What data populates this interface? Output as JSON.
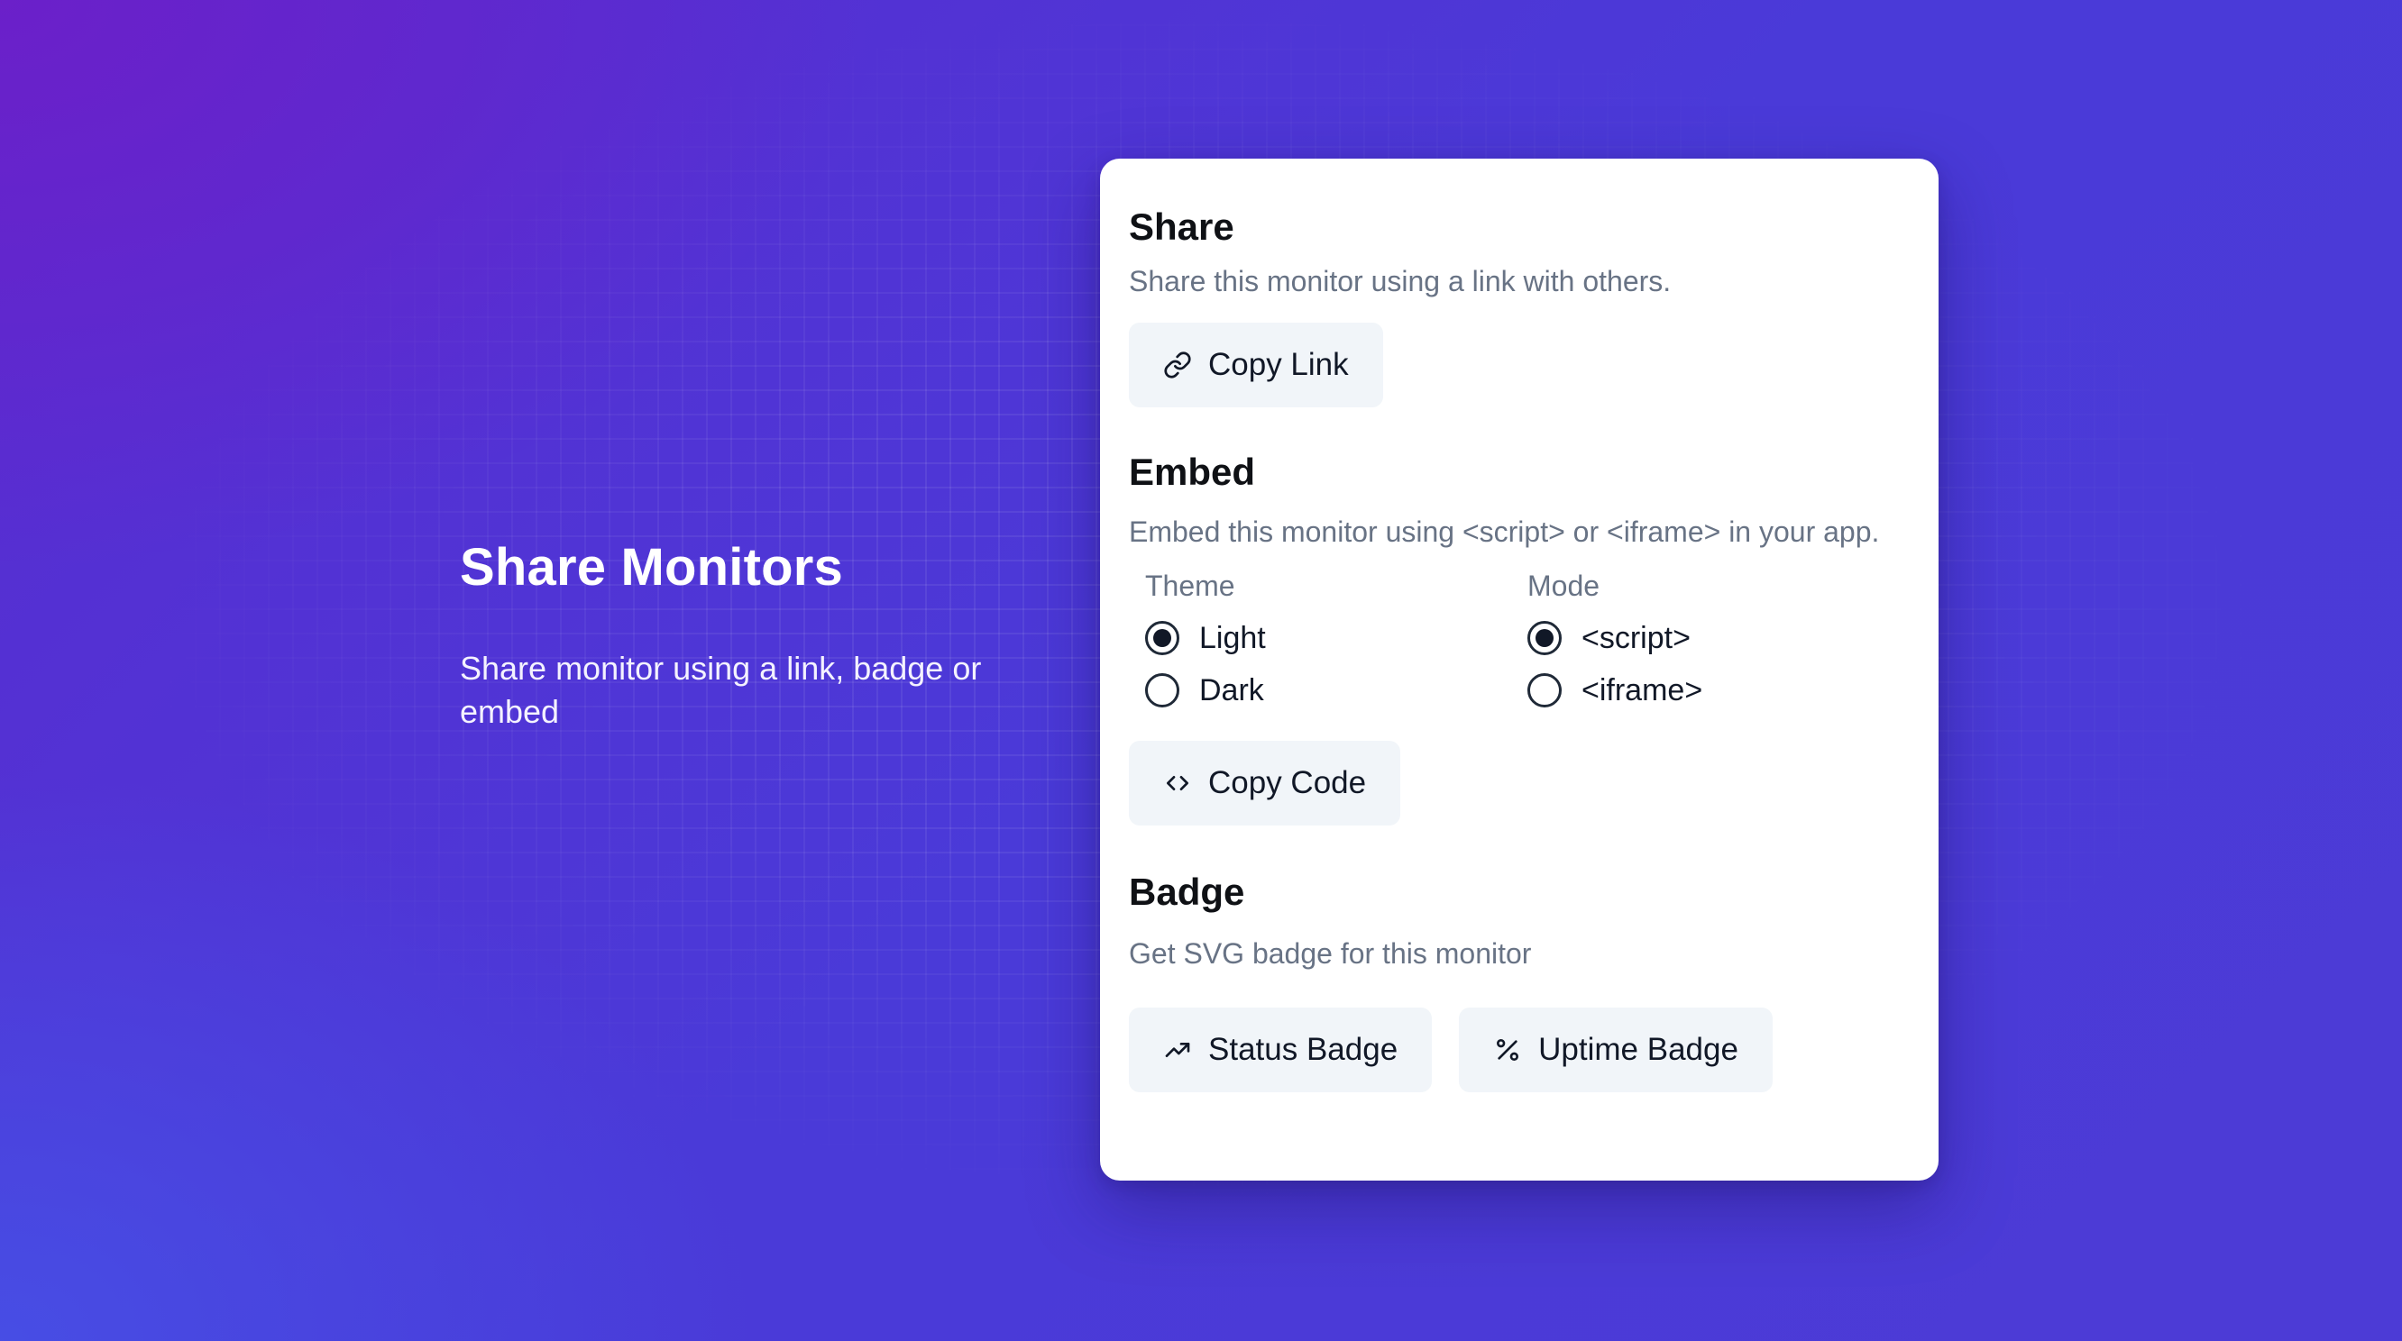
{
  "intro": {
    "title": "Share Monitors",
    "description": "Share monitor using a link, badge or embed"
  },
  "share": {
    "title": "Share",
    "description": "Share this monitor using a link with others.",
    "copy_link_label": "Copy Link",
    "copy_link_icon": "link-icon"
  },
  "embed": {
    "title": "Embed",
    "description": "Embed this monitor using <script> or <iframe> in your app.",
    "theme": {
      "label": "Theme",
      "options": [
        {
          "label": "Light",
          "selected": true
        },
        {
          "label": "Dark",
          "selected": false
        }
      ]
    },
    "mode": {
      "label": "Mode",
      "options": [
        {
          "label": "<script>",
          "selected": true
        },
        {
          "label": "<iframe>",
          "selected": false
        }
      ]
    },
    "copy_code_label": "Copy Code",
    "copy_code_icon": "code-icon"
  },
  "badge": {
    "title": "Badge",
    "description": "Get SVG badge for this monitor",
    "status_badge_label": "Status Badge",
    "status_badge_icon": "trending-up-icon",
    "uptime_badge_label": "Uptime Badge",
    "uptime_badge_icon": "percent-icon"
  },
  "colors": {
    "background_start": "#6a22c8",
    "background_end": "#4c3bd6",
    "card": "#ffffff",
    "button_bg": "#f1f5f9",
    "muted_text": "#687385"
  }
}
